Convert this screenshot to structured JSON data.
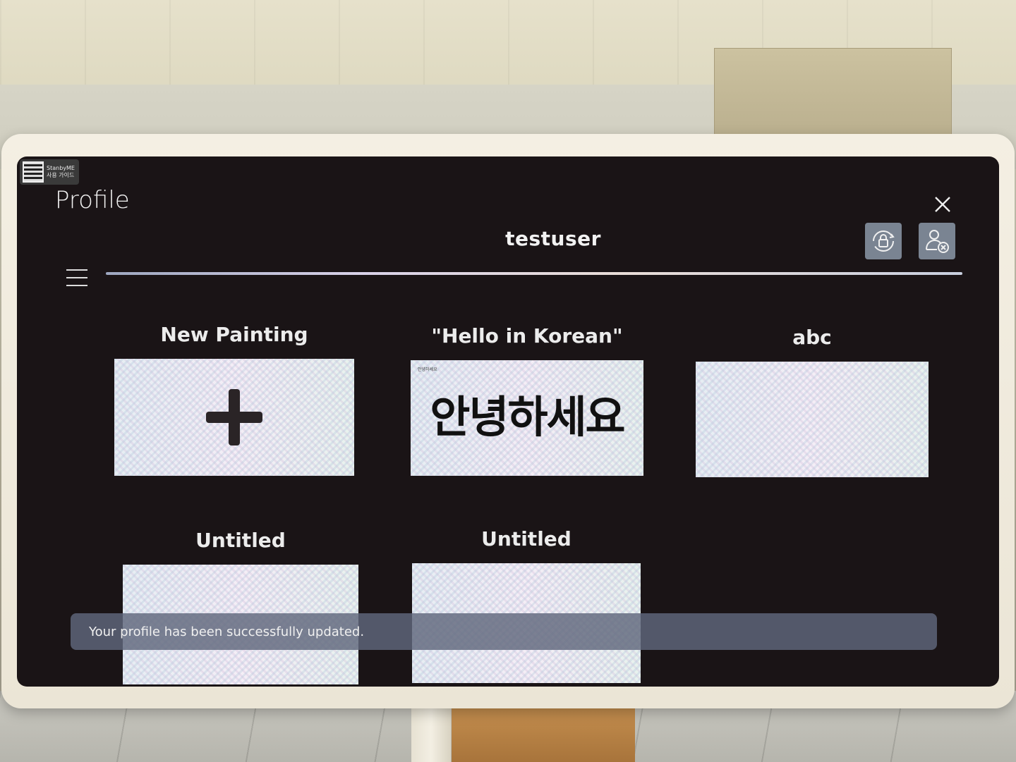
{
  "sticker": {
    "line1": "StanbyME",
    "line2": "사용 가이드"
  },
  "header": {
    "title": "Profile",
    "username": "testuser",
    "close_icon": "close-icon",
    "buttons": [
      {
        "name": "lock-sync-icon"
      },
      {
        "name": "remove-user-icon"
      }
    ]
  },
  "paintings": [
    {
      "label": "New Painting",
      "kind": "new"
    },
    {
      "label": "\"Hello in Korean\"",
      "kind": "drawing",
      "small_text": "안녕하세요",
      "content": "안녕하세요"
    },
    {
      "label": "abc",
      "kind": "blank"
    },
    {
      "label": "Untitled",
      "kind": "blank"
    },
    {
      "label": "Untitled",
      "kind": "blank"
    }
  ],
  "toast": {
    "message": "Your profile has been successfully updated."
  },
  "colors": {
    "screen_bg": "#1a1416",
    "toast_bg": "#60687c",
    "icon_button_bg": "#7a8492"
  }
}
